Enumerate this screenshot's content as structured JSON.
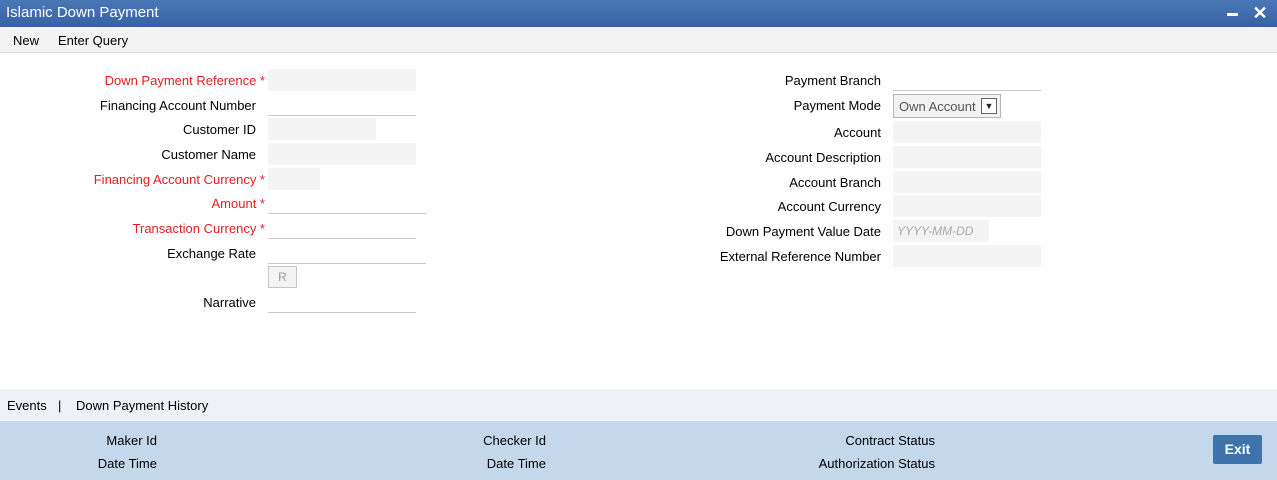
{
  "window": {
    "title": "Islamic Down Payment"
  },
  "toolbar": {
    "new_label": "New",
    "enter_query_label": "Enter Query"
  },
  "form_left": {
    "down_payment_reference": "Down Payment Reference *",
    "financing_account_number": "Financing Account Number",
    "customer_id": "Customer ID",
    "customer_name": "Customer Name",
    "financing_account_currency": "Financing Account Currency *",
    "amount": "Amount *",
    "transaction_currency": "Transaction Currency *",
    "exchange_rate": "Exchange Rate",
    "r_button": "R",
    "narrative": "Narrative"
  },
  "form_right": {
    "payment_branch": "Payment Branch",
    "payment_mode": "Payment Mode",
    "payment_mode_value": "Own Account",
    "account": "Account",
    "account_description": "Account Description",
    "account_branch": "Account Branch",
    "account_currency": "Account Currency",
    "down_payment_value_date": "Down Payment Value Date",
    "date_placeholder": "YYYY-MM-DD",
    "external_reference_number": "External Reference Number"
  },
  "subbar": {
    "events": "Events",
    "separator": "|",
    "history": "Down Payment History"
  },
  "footer": {
    "maker_id": "Maker Id",
    "date_time_1": "Date Time",
    "checker_id": "Checker Id",
    "date_time_2": "Date Time",
    "contract_status": "Contract Status",
    "authorization_status": "Authorization Status",
    "exit": "Exit"
  }
}
